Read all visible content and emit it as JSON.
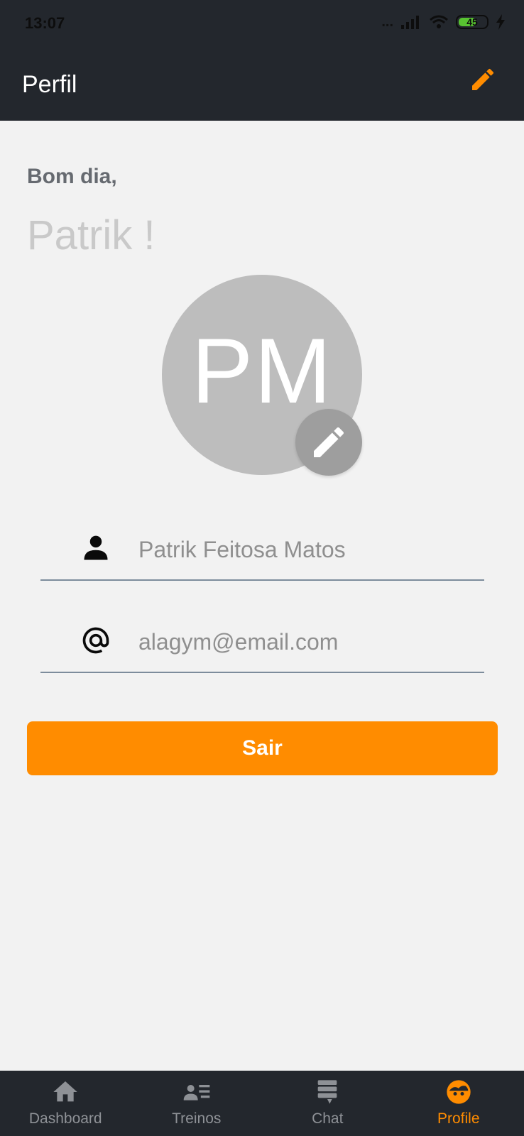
{
  "status_bar": {
    "time": "13:07",
    "signal": "...",
    "battery": "45"
  },
  "app_bar": {
    "title": "Perfil",
    "edit_icon": "pencil-icon"
  },
  "greeting": "Bom dia,",
  "user_name": "Patrik !",
  "avatar": {
    "initials": "PM",
    "edit_icon": "pencil-icon"
  },
  "fields": {
    "name": {
      "icon": "person-icon",
      "value": "Patrik Feitosa Matos"
    },
    "email": {
      "icon": "at-icon",
      "value": "alagym@email.com"
    }
  },
  "logout_button": "Sair",
  "bottom_nav": {
    "items": [
      {
        "label": "Dashboard",
        "icon": "home-icon"
      },
      {
        "label": "Treinos",
        "icon": "list-person-icon"
      },
      {
        "label": "Chat",
        "icon": "chat-icon"
      },
      {
        "label": "Profile",
        "icon": "profile-face-icon",
        "active": true
      }
    ]
  },
  "colors": {
    "accent": "#ff8c00",
    "appbar": "#23272d",
    "background": "#f2f2f2",
    "avatar": "#bdbdbd"
  }
}
